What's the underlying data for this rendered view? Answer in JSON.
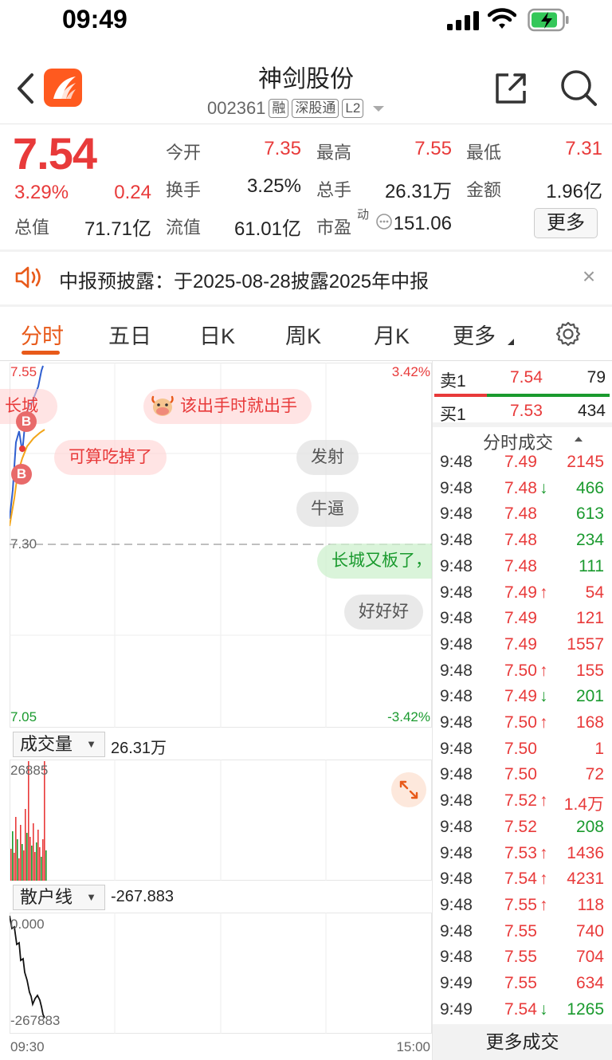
{
  "status_bar": {
    "time": "09:49"
  },
  "header": {
    "name": "神剑股份",
    "code": "002361",
    "tags": [
      "融",
      "深股通",
      "L2"
    ]
  },
  "quote": {
    "price": "7.54",
    "change_pct": "3.29%",
    "change_abs": "0.24",
    "fields": [
      {
        "label": "今开",
        "value": "7.35"
      },
      {
        "label": "最高",
        "value": "7.55"
      },
      {
        "label": "最低",
        "value": "7.31"
      },
      {
        "label": "换手",
        "value": "3.25%"
      },
      {
        "label": "总手",
        "value": "26.31万"
      },
      {
        "label": "金额",
        "value": "1.96亿"
      },
      {
        "label": "总值",
        "value": "71.71亿"
      },
      {
        "label": "流值",
        "value": "61.01亿"
      },
      {
        "label": "市盈",
        "value": "151.06",
        "sup": "动"
      }
    ],
    "more_label": "更多",
    "colors": {
      "up": "#e83a3a",
      "down": "#1a9a2e",
      "accent": "#e85a1a"
    }
  },
  "notice": {
    "text": "中报预披露：于2025-08-28披露2025年中报",
    "close": "×"
  },
  "tabs": [
    "分时",
    "五日",
    "日K",
    "周K",
    "月K",
    "更多"
  ],
  "chart": {
    "price_top": "7.55",
    "price_mid": "7.30",
    "price_bottom": "7.05",
    "pct_top": "3.42%",
    "pct_bottom": "-3.42%",
    "danmaku": [
      {
        "text": "长城",
        "style": "red"
      },
      {
        "text": "该出手时就出手",
        "style": "red"
      },
      {
        "text": "可算吃掉了",
        "style": "red"
      },
      {
        "text": "发射",
        "style": "grey"
      },
      {
        "text": "牛逼",
        "style": "grey"
      },
      {
        "text": "长城又板了，",
        "style": "green"
      },
      {
        "text": "好好好",
        "style": "grey"
      }
    ],
    "markers": [
      "B",
      "B"
    ],
    "volume_selector": "成交量",
    "volume_value": "26.31万",
    "volume_max": "26885",
    "retail_selector": "散户线",
    "retail_value": "-267.883",
    "retail_top": "0.000",
    "retail_bottom": "-267883",
    "time_start": "09:30",
    "time_end": "15:00"
  },
  "orderbook": {
    "ask": {
      "label": "卖1",
      "price": "7.54",
      "vol": "79"
    },
    "bid": {
      "label": "买1",
      "price": "7.53",
      "vol": "434"
    },
    "bid_share": 0.3
  },
  "trades_title": "分时成交",
  "trades": [
    {
      "time": "9:48",
      "price": "7.49",
      "arrow": "",
      "vol": "2145",
      "vcolor": "red"
    },
    {
      "time": "9:48",
      "price": "7.48",
      "arrow": "↓",
      "vol": "466",
      "vcolor": "green"
    },
    {
      "time": "9:48",
      "price": "7.48",
      "arrow": "",
      "vol": "613",
      "vcolor": "green"
    },
    {
      "time": "9:48",
      "price": "7.48",
      "arrow": "",
      "vol": "234",
      "vcolor": "green"
    },
    {
      "time": "9:48",
      "price": "7.48",
      "arrow": "",
      "vol": "111",
      "vcolor": "green"
    },
    {
      "time": "9:48",
      "price": "7.49",
      "arrow": "↑",
      "vol": "54",
      "vcolor": "red"
    },
    {
      "time": "9:48",
      "price": "7.49",
      "arrow": "",
      "vol": "121",
      "vcolor": "red"
    },
    {
      "time": "9:48",
      "price": "7.49",
      "arrow": "",
      "vol": "1557",
      "vcolor": "red"
    },
    {
      "time": "9:48",
      "price": "7.50",
      "arrow": "↑",
      "vol": "155",
      "vcolor": "red"
    },
    {
      "time": "9:48",
      "price": "7.49",
      "arrow": "↓",
      "vol": "201",
      "vcolor": "green"
    },
    {
      "time": "9:48",
      "price": "7.50",
      "arrow": "↑",
      "vol": "168",
      "vcolor": "red"
    },
    {
      "time": "9:48",
      "price": "7.50",
      "arrow": "",
      "vol": "1",
      "vcolor": "red"
    },
    {
      "time": "9:48",
      "price": "7.50",
      "arrow": "",
      "vol": "72",
      "vcolor": "red"
    },
    {
      "time": "9:48",
      "price": "7.52",
      "arrow": "↑",
      "vol": "1.4万",
      "vcolor": "red"
    },
    {
      "time": "9:48",
      "price": "7.52",
      "arrow": "",
      "vol": "208",
      "vcolor": "green"
    },
    {
      "time": "9:48",
      "price": "7.53",
      "arrow": "↑",
      "vol": "1436",
      "vcolor": "red"
    },
    {
      "time": "9:48",
      "price": "7.54",
      "arrow": "↑",
      "vol": "4231",
      "vcolor": "red"
    },
    {
      "time": "9:48",
      "price": "7.55",
      "arrow": "↑",
      "vol": "118",
      "vcolor": "red"
    },
    {
      "time": "9:48",
      "price": "7.55",
      "arrow": "",
      "vol": "740",
      "vcolor": "red"
    },
    {
      "time": "9:48",
      "price": "7.55",
      "arrow": "",
      "vol": "704",
      "vcolor": "red"
    },
    {
      "time": "9:49",
      "price": "7.55",
      "arrow": "",
      "vol": "634",
      "vcolor": "red"
    },
    {
      "time": "9:49",
      "price": "7.54",
      "arrow": "↓",
      "vol": "1265",
      "vcolor": "green"
    }
  ],
  "more_trades_label": "更多成交"
}
